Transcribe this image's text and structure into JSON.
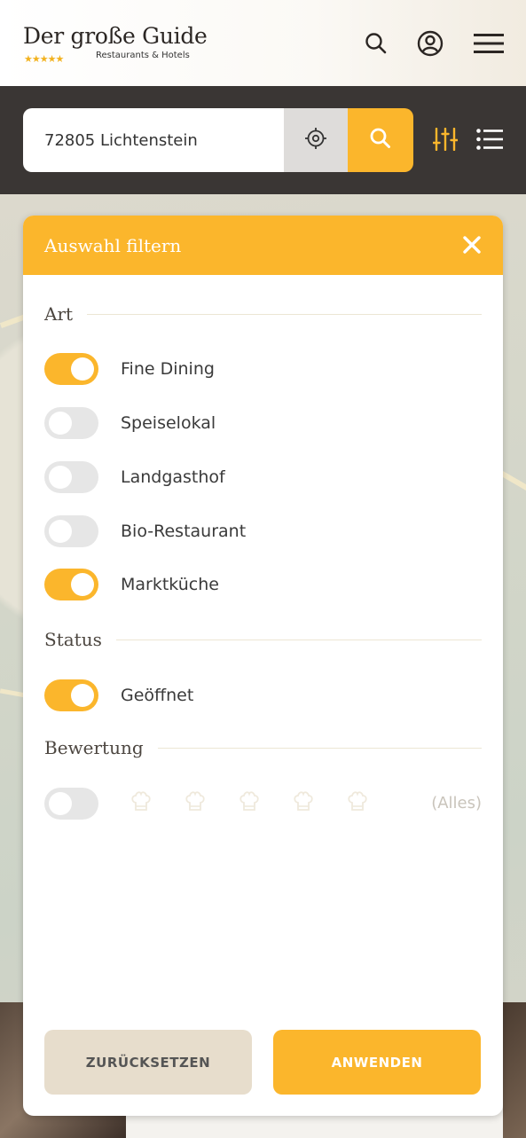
{
  "header": {
    "logo_title": "Der große Guide",
    "logo_stars": "★★★★★",
    "logo_subtitle": "Restaurants & Hotels",
    "icons": [
      "search-icon",
      "account-icon",
      "menu-icon"
    ]
  },
  "search": {
    "location_value": "72805 Lichtenstein",
    "icons": [
      "locate-icon",
      "search-icon",
      "filter-sliders-icon",
      "list-view-icon"
    ]
  },
  "filter": {
    "title": "Auswahl filtern",
    "close_icon": "close-icon",
    "art": {
      "heading": "Art",
      "items": [
        {
          "label": "Fine Dining",
          "on": true
        },
        {
          "label": "Speiselokal",
          "on": false
        },
        {
          "label": "Landgasthof",
          "on": false
        },
        {
          "label": "Bio-Restaurant",
          "on": false
        },
        {
          "label": "Marktküche",
          "on": true
        }
      ]
    },
    "status": {
      "heading": "Status",
      "items": [
        {
          "label": "Geöffnet",
          "on": true
        }
      ]
    },
    "rating": {
      "heading": "Bewertung",
      "enabled": false,
      "chef_hats": 5,
      "label": "(Alles)"
    },
    "buttons": {
      "reset": "ZURÜCKSETZEN",
      "apply": "ANWENDEN"
    }
  },
  "colors": {
    "accent": "#fbb62c",
    "dark_bar": "#3a3634",
    "toggle_off": "#e6e6e6",
    "reset_bg": "#e7ddcc"
  }
}
